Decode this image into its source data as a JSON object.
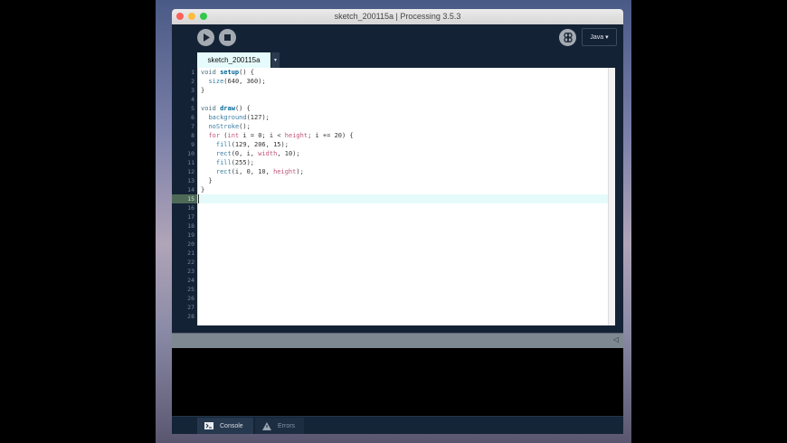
{
  "window": {
    "title": "sketch_200115a | Processing 3.5.3"
  },
  "toolbar": {
    "run_icon": "play-icon",
    "stop_icon": "stop-icon",
    "debugger_icon": "butterfly-icon",
    "mode_label": "Java ▾"
  },
  "tabs": [
    {
      "label": "sketch_200115a"
    }
  ],
  "tab_menu": "▾",
  "editor": {
    "current_line": 15,
    "line_numbers": [
      "1",
      "2",
      "3",
      "4",
      "5",
      "6",
      "7",
      "8",
      "9",
      "10",
      "11",
      "12",
      "13",
      "14",
      "15",
      "16",
      "17",
      "18",
      "19",
      "20",
      "21",
      "22",
      "23",
      "24",
      "25",
      "26",
      "27",
      "28"
    ]
  },
  "status": {
    "collapse_icon": "◁"
  },
  "bottom_tabs": [
    {
      "label": "Console",
      "icon": "terminal-icon"
    },
    {
      "label": "Errors",
      "icon": "warning-icon"
    }
  ]
}
